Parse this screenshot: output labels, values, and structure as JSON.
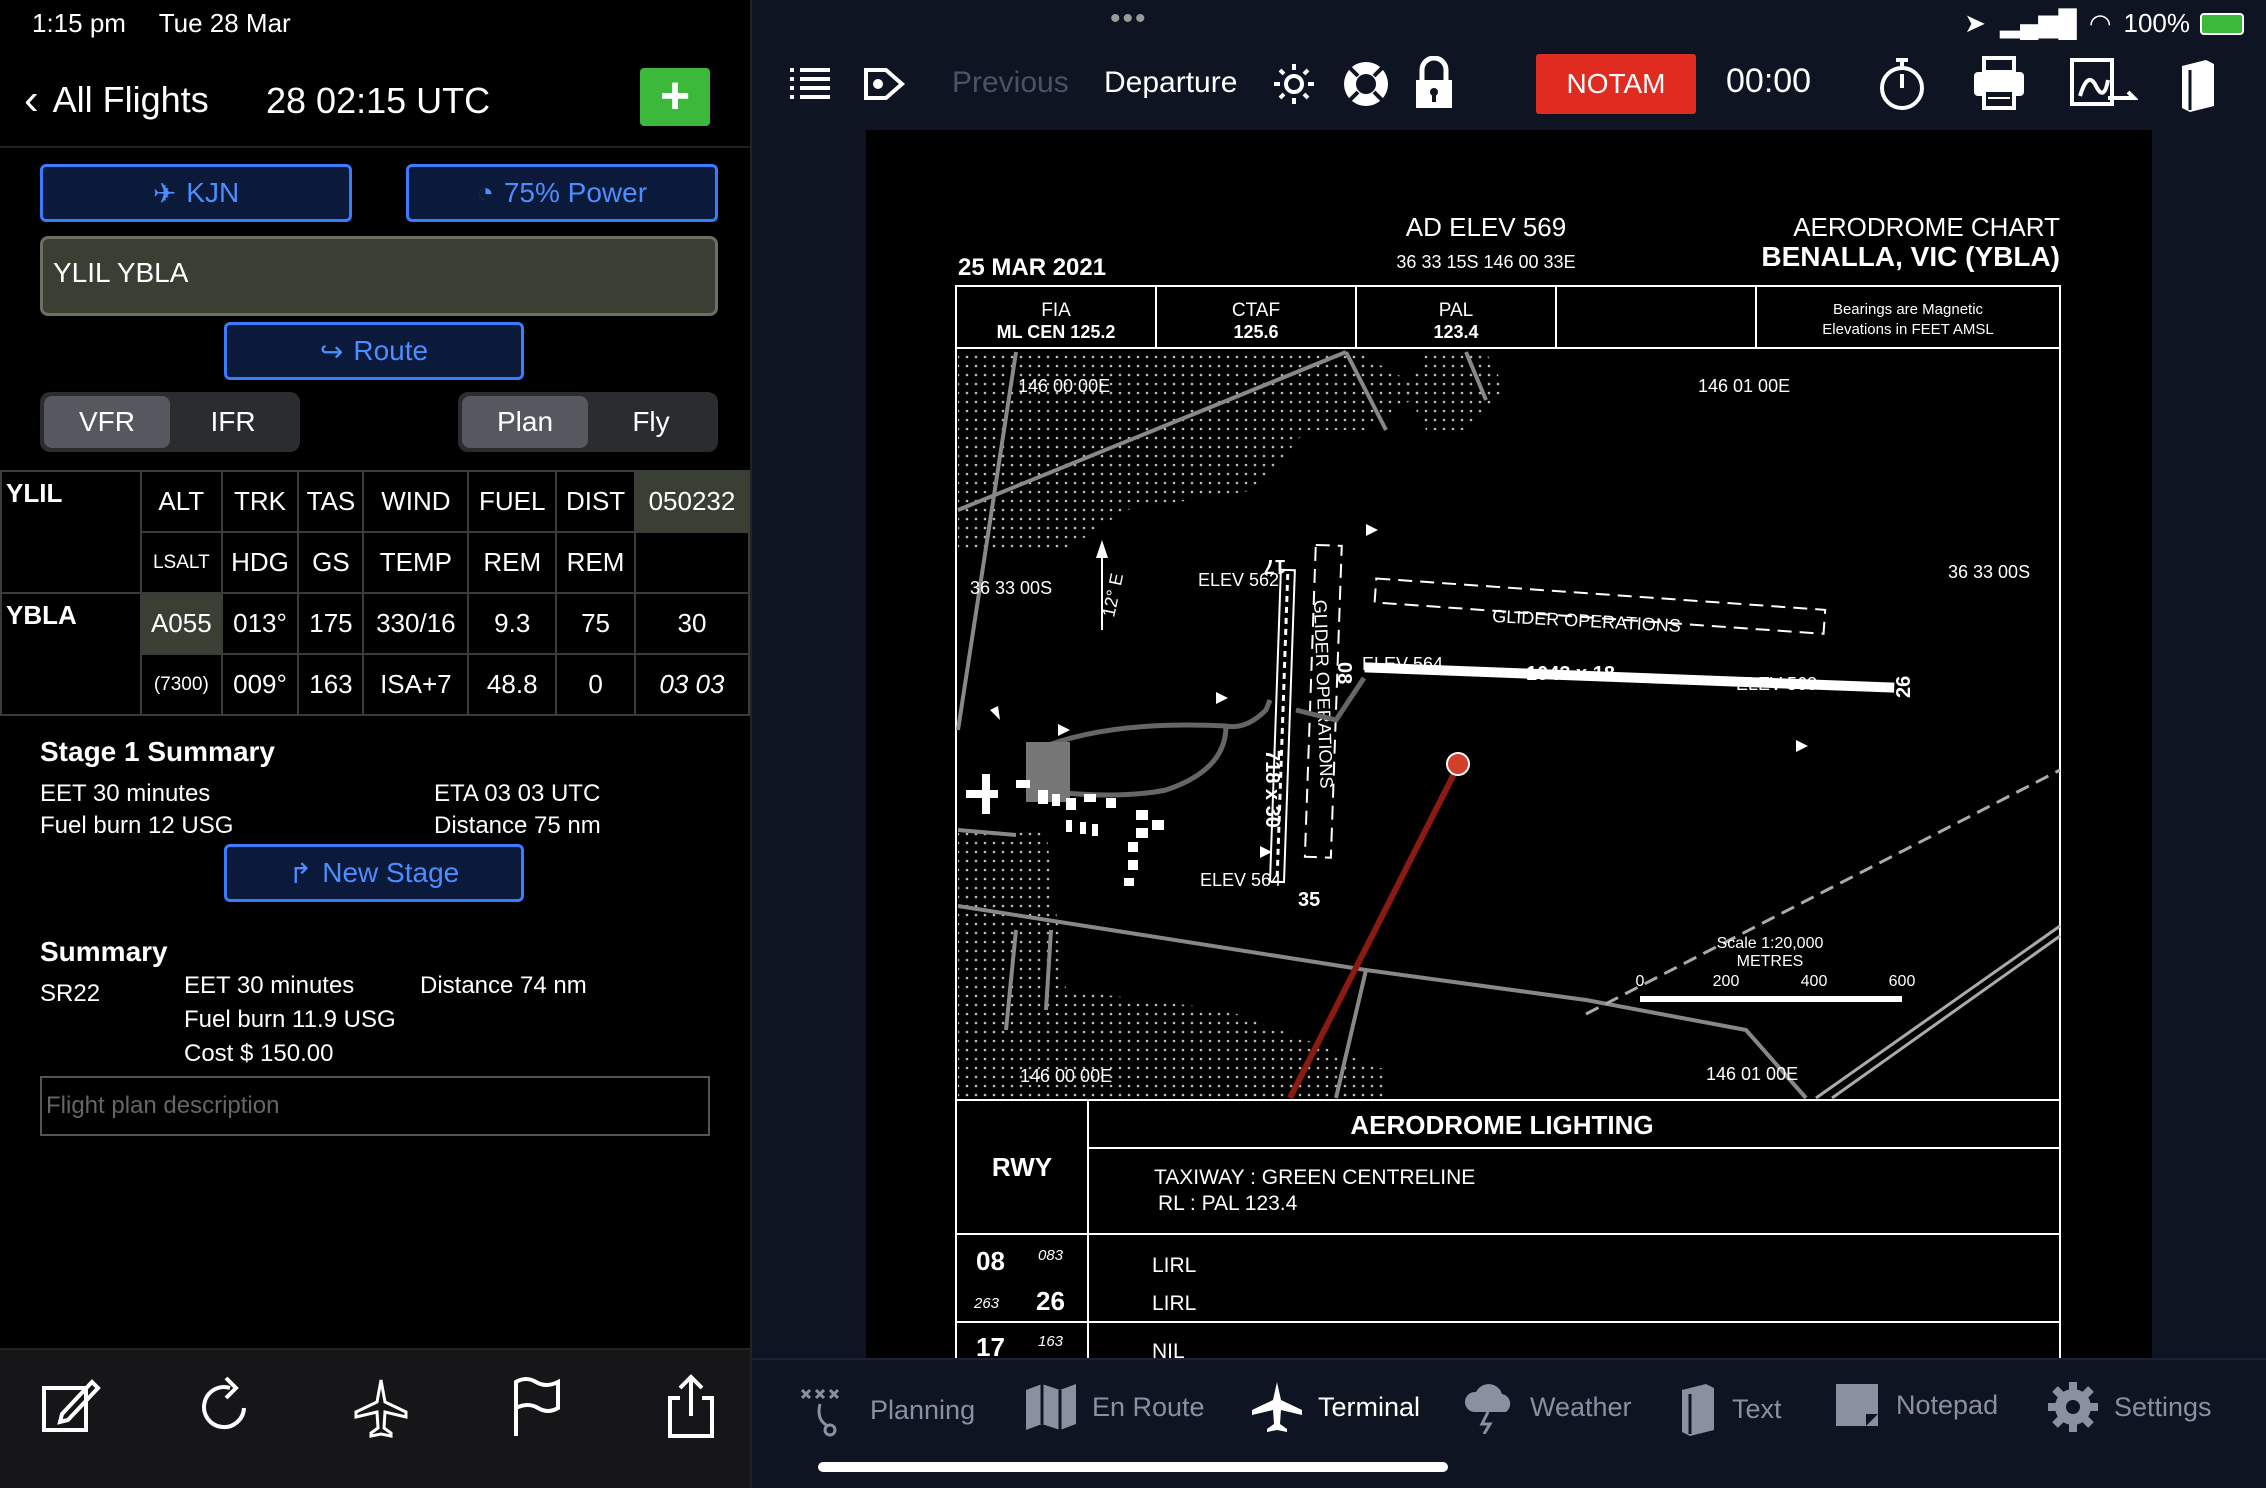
{
  "status": {
    "time": "1:15 pm",
    "date": "Tue 28 Mar",
    "battery": "100%"
  },
  "nav": {
    "back_label": "All Flights",
    "utc": "28 02:15 UTC",
    "add_label": "+"
  },
  "flight": {
    "aircraft_btn": "KJN",
    "power_btn": "75% Power",
    "route_text": "YLIL YBLA",
    "route_btn": "Route",
    "rules": [
      "VFR",
      "IFR"
    ],
    "rules_selected": "VFR",
    "mode": [
      "Plan",
      "Fly"
    ],
    "mode_selected": "Plan"
  },
  "log": {
    "from": "YLIL",
    "to": "YBLA",
    "head1": [
      "ALT",
      "TRK",
      "TAS",
      "WIND",
      "FUEL",
      "DIST",
      "050232"
    ],
    "head2": [
      "LSALT",
      "HDG",
      "GS",
      "TEMP",
      "REM",
      "REM",
      ""
    ],
    "row1": [
      "A055",
      "013°",
      "175",
      "330/16",
      "9.3",
      "75",
      "30"
    ],
    "row2": [
      "(7300)",
      "009°",
      "163",
      "ISA+7",
      "48.8",
      "0",
      "03 03"
    ]
  },
  "stage": {
    "title": "Stage 1 Summary",
    "eet": "EET 30 minutes",
    "eta": "ETA 03 03 UTC",
    "fuel": "Fuel burn 12 USG",
    "dist": "Distance 75 nm",
    "new_stage_btn": "New Stage"
  },
  "summary": {
    "title": "Summary",
    "aircraft": "SR22",
    "eet": "EET 30 minutes",
    "dist": "Distance 74 nm",
    "fuel": "Fuel burn 11.9 USG",
    "cost": "Cost $ 150.00",
    "desc_placeholder": "Flight plan description"
  },
  "toolbar": {
    "previous": "Previous",
    "title": "Departure",
    "notam": "NOTAM",
    "timer": "00:00"
  },
  "chart": {
    "date": "25 MAR 2021",
    "ad_elev": "AD ELEV 569",
    "coords": "36 33 15S 146 00 33E",
    "type": "AERODROME CHART",
    "name": "BENALLA, VIC (YBLA)",
    "freq": [
      {
        "label": "FIA",
        "value": "ML CEN 125.2"
      },
      {
        "label": "CTAF",
        "value": "125.6"
      },
      {
        "label": "PAL",
        "value": "123.4"
      },
      {
        "label": "",
        "value": ""
      }
    ],
    "note1": "Bearings are Magnetic",
    "note2": "Elevations in FEET AMSL",
    "lon_left": "146 00 00E",
    "lon_right": "146 01 00E",
    "lat_left": "36 33 00S",
    "lat_right": "36 33 00S",
    "var": "12° E",
    "elev562": "ELEV 562",
    "elev564a": "ELEV 564",
    "elev564b": "ELEV 564",
    "elev568": "ELEV 568",
    "rwy_main": "1043 x 18",
    "rwy_cross": "718 x 30",
    "glider1": "GLIDER OPERATIONS",
    "glider2": "GLIDER OPERATIONS",
    "rw08": "08",
    "rw26": "26",
    "rw17": "17",
    "rw35": "35",
    "scale": "Scale 1:20,000",
    "metres": "METRES",
    "scale_ticks": [
      "0",
      "200",
      "400",
      "600"
    ],
    "lighting_title": "AERODROME LIGHTING",
    "rwy_head": "RWY",
    "taxi": "TAXIWAY : GREEN CENTRELINE",
    "rl": "RL           : PAL 123.4",
    "lighting": [
      {
        "rwy": "08",
        "brg": "083",
        "light": "LIRL"
      },
      {
        "rwy": "26",
        "brg": "263",
        "light": "LIRL"
      },
      {
        "rwy": "17",
        "brg": "163",
        "light": "NIL"
      }
    ]
  },
  "tabs": [
    "Planning",
    "En Route",
    "Terminal",
    "Weather",
    "Text",
    "Notepad",
    "Settings"
  ],
  "tab_selected": "Terminal",
  "colors": {
    "accent": "#3a7bff",
    "notam": "#e02b20",
    "add": "#3cb83a"
  }
}
